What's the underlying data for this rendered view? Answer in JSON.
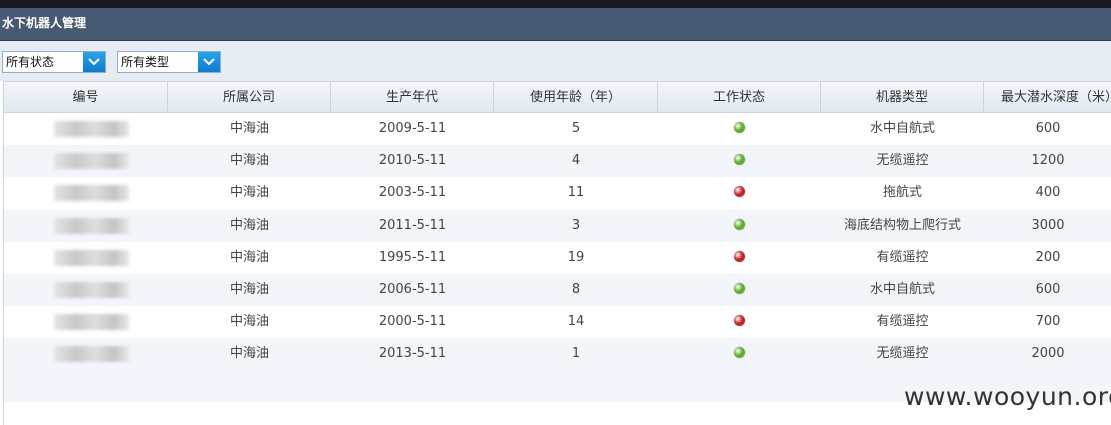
{
  "window": {
    "title": "水下机器人管理"
  },
  "filters": {
    "status": {
      "value": "所有状态"
    },
    "type": {
      "value": "所有类型"
    }
  },
  "table": {
    "columns": [
      "编号",
      "所属公司",
      "生产年代",
      "使用年龄（年）",
      "工作状态",
      "机器类型",
      "最大潜水深度（米）"
    ],
    "rows": [
      {
        "company": "中海油",
        "date": "2009-5-11",
        "age": "5",
        "status": "green",
        "type": "水中自航式",
        "depth": "600"
      },
      {
        "company": "中海油",
        "date": "2010-5-11",
        "age": "4",
        "status": "green",
        "type": "无缆遥控",
        "depth": "1200"
      },
      {
        "company": "中海油",
        "date": "2003-5-11",
        "age": "11",
        "status": "red",
        "type": "拖航式",
        "depth": "400"
      },
      {
        "company": "中海油",
        "date": "2011-5-11",
        "age": "3",
        "status": "green",
        "type": "海底结构物上爬行式",
        "depth": "3000"
      },
      {
        "company": "中海油",
        "date": "1995-5-11",
        "age": "19",
        "status": "red",
        "type": "有缆遥控",
        "depth": "200"
      },
      {
        "company": "中海油",
        "date": "2006-5-11",
        "age": "8",
        "status": "green",
        "type": "水中自航式",
        "depth": "600"
      },
      {
        "company": "中海油",
        "date": "2000-5-11",
        "age": "14",
        "status": "red",
        "type": "有缆遥控",
        "depth": "700"
      },
      {
        "company": "中海油",
        "date": "2013-5-11",
        "age": "1",
        "status": "green",
        "type": "无缆遥控",
        "depth": "2000"
      }
    ]
  },
  "status_colors": {
    "green": "#5fae2e",
    "red": "#c0282a"
  },
  "watermark": "www.wooyun.org"
}
